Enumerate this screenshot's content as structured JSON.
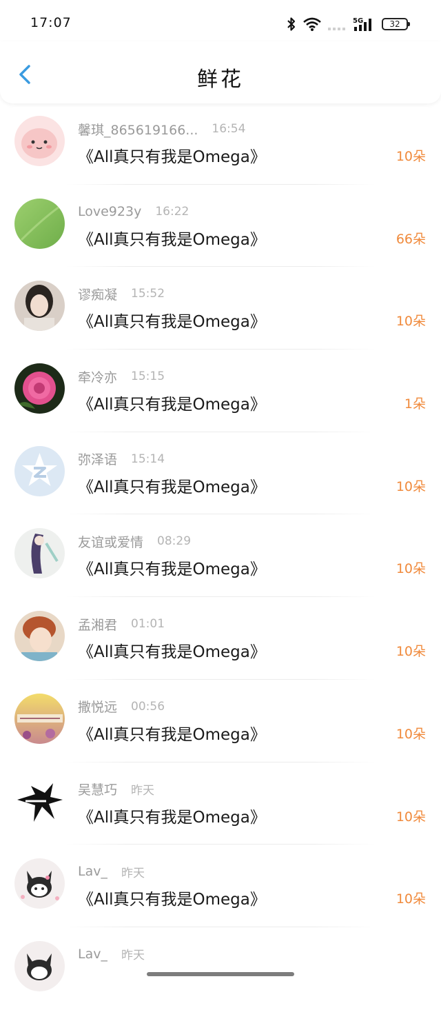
{
  "status_bar": {
    "time": "17:07",
    "battery": "32",
    "network": "5G"
  },
  "header": {
    "title": "鲜花",
    "back_icon": "chevron-left-icon"
  },
  "colors": {
    "accent_blue": "#3a9be0",
    "amount_orange": "#f08a3c"
  },
  "rows": [
    {
      "name": "馨琪_865619166...",
      "time": "16:54",
      "book": "《All真只有我是Omega》",
      "amount": "10朵"
    },
    {
      "name": "Love923y",
      "time": "16:22",
      "book": "《All真只有我是Omega》",
      "amount": "66朵"
    },
    {
      "name": "谬痴凝",
      "time": "15:52",
      "book": "《All真只有我是Omega》",
      "amount": "10朵"
    },
    {
      "name": "牵冷亦",
      "time": "15:15",
      "book": "《All真只有我是Omega》",
      "amount": "1朵"
    },
    {
      "name": "弥泽语",
      "time": "15:14",
      "book": "《All真只有我是Omega》",
      "amount": "10朵"
    },
    {
      "name": "友谊或爱情",
      "time": "08:29",
      "book": "《All真只有我是Omega》",
      "amount": "10朵"
    },
    {
      "name": "孟湘君",
      "time": "01:01",
      "book": "《All真只有我是Omega》",
      "amount": "10朵"
    },
    {
      "name": "撒悦远",
      "time": "00:56",
      "book": "《All真只有我是Omega》",
      "amount": "10朵"
    },
    {
      "name": "吴慧巧",
      "time": "昨天",
      "book": "《All真只有我是Omega》",
      "amount": "10朵"
    },
    {
      "name": "Lav_",
      "time": "昨天",
      "book": "《All真只有我是Omega》",
      "amount": "10朵"
    },
    {
      "name": "Lav_",
      "time": "昨天",
      "book": "",
      "amount": ""
    }
  ]
}
